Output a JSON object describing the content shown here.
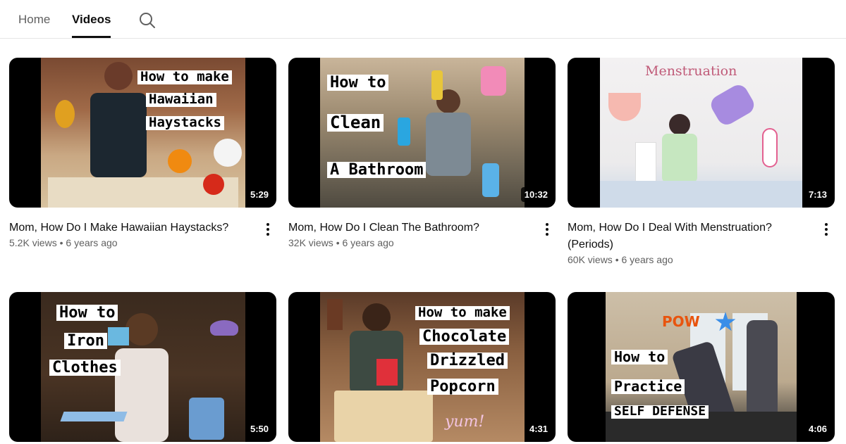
{
  "tabs": {
    "home": "Home",
    "videos": "Videos"
  },
  "icons": {
    "search": "search-icon",
    "more": "more-vert-icon"
  },
  "videos": [
    {
      "title": "Mom, How Do I Make Hawaiian Haystacks?",
      "views": "5.2K views",
      "age": "6 years ago",
      "duration": "5:29",
      "captions": [
        "How to make",
        "Hawaiian",
        "Haystacks"
      ]
    },
    {
      "title": "Mom, How Do I Clean The Bathroom?",
      "views": "32K views",
      "age": "6 years ago",
      "duration": "10:32",
      "captions": [
        "How to",
        "Clean",
        "A Bathroom"
      ]
    },
    {
      "title": "Mom, How Do I Deal With Menstruation? (Periods)",
      "views": "60K views",
      "age": "6 years ago",
      "duration": "7:13",
      "captions": [
        "Menstruation"
      ]
    },
    {
      "title": "",
      "views": "",
      "age": "",
      "duration": "5:50",
      "captions": [
        "How to",
        "Iron",
        "Clothes"
      ]
    },
    {
      "title": "",
      "views": "",
      "age": "",
      "duration": "4:31",
      "captions": [
        "How to make",
        "Chocolate",
        "Drizzled",
        "Popcorn",
        "yum!"
      ]
    },
    {
      "title": "",
      "views": "",
      "age": "",
      "duration": "4:06",
      "captions": [
        "POW",
        "How to",
        "Practice",
        "SELF DEFENSE"
      ]
    }
  ],
  "separator": "•"
}
